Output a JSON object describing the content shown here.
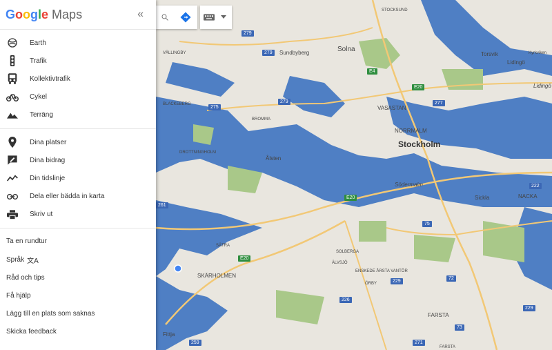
{
  "brand": {
    "google": "Google",
    "maps": "Maps",
    "collapse": "«"
  },
  "menu1": [
    {
      "label": "Earth",
      "icon": "earth-icon"
    },
    {
      "label": "Trafik",
      "icon": "traffic-icon"
    },
    {
      "label": "Kollektivtrafik",
      "icon": "transit-icon"
    },
    {
      "label": "Cykel",
      "icon": "bike-icon"
    },
    {
      "label": "Terräng",
      "icon": "terrain-icon"
    }
  ],
  "menu2": [
    {
      "label": "Dina platser",
      "icon": "place-icon"
    },
    {
      "label": "Dina bidrag",
      "icon": "contrib-icon"
    },
    {
      "label": "Din tidslinje",
      "icon": "timeline-icon"
    },
    {
      "label": "Dela eller bädda in karta",
      "icon": "link-icon"
    },
    {
      "label": "Skriv ut",
      "icon": "print-icon"
    }
  ],
  "menu3": [
    {
      "label": "Ta en rundtur"
    },
    {
      "label": "Språk"
    },
    {
      "label": "Råd och tips"
    },
    {
      "label": "Få hjälp"
    },
    {
      "label": "Lägg till en plats som saknas"
    },
    {
      "label": "Skicka feedback"
    }
  ],
  "map_labels": {
    "stockholm": "Stockholm",
    "solna": "Solna",
    "sundbyberg": "Sundbyberg",
    "vasastan": "VASASTAN",
    "normalm": "NORRMALM",
    "sodermalm": "Södermalm",
    "alsten": "Ålsten",
    "bromma": "BROMMA",
    "vallingby": "VÄLLINGBY",
    "blackeberg": "BLACKEBERG",
    "drottningholm": "DROTTNINGHOLM",
    "torsvik": "Torsvik",
    "lidingo": "Lidingö",
    "lidingo2": "Lidingö",
    "kyrkviken": "Kyrkviken",
    "sickla": "Sickla",
    "nacka": "NACKA",
    "skarholmen": "SKÄRHOLMEN",
    "satra": "SÄTRA",
    "solberga": "SOLBERGA",
    "alvsjo": "ÄLVSJÖ",
    "enskede": "ENSKEDE ÅRSTA VANTÖR",
    "orby": "ÖRBY",
    "farsta": "FARSTA",
    "fittja": "Fittja",
    "stocksund": "STOCKSUND",
    "farsta_s": "FARSTA"
  },
  "shields": [
    "279",
    "279",
    "279",
    "E4",
    "E20",
    "277",
    "275",
    "E20",
    "222",
    "261",
    "75",
    "E20",
    "229",
    "72",
    "226",
    "73",
    "229",
    "259",
    "271"
  ]
}
